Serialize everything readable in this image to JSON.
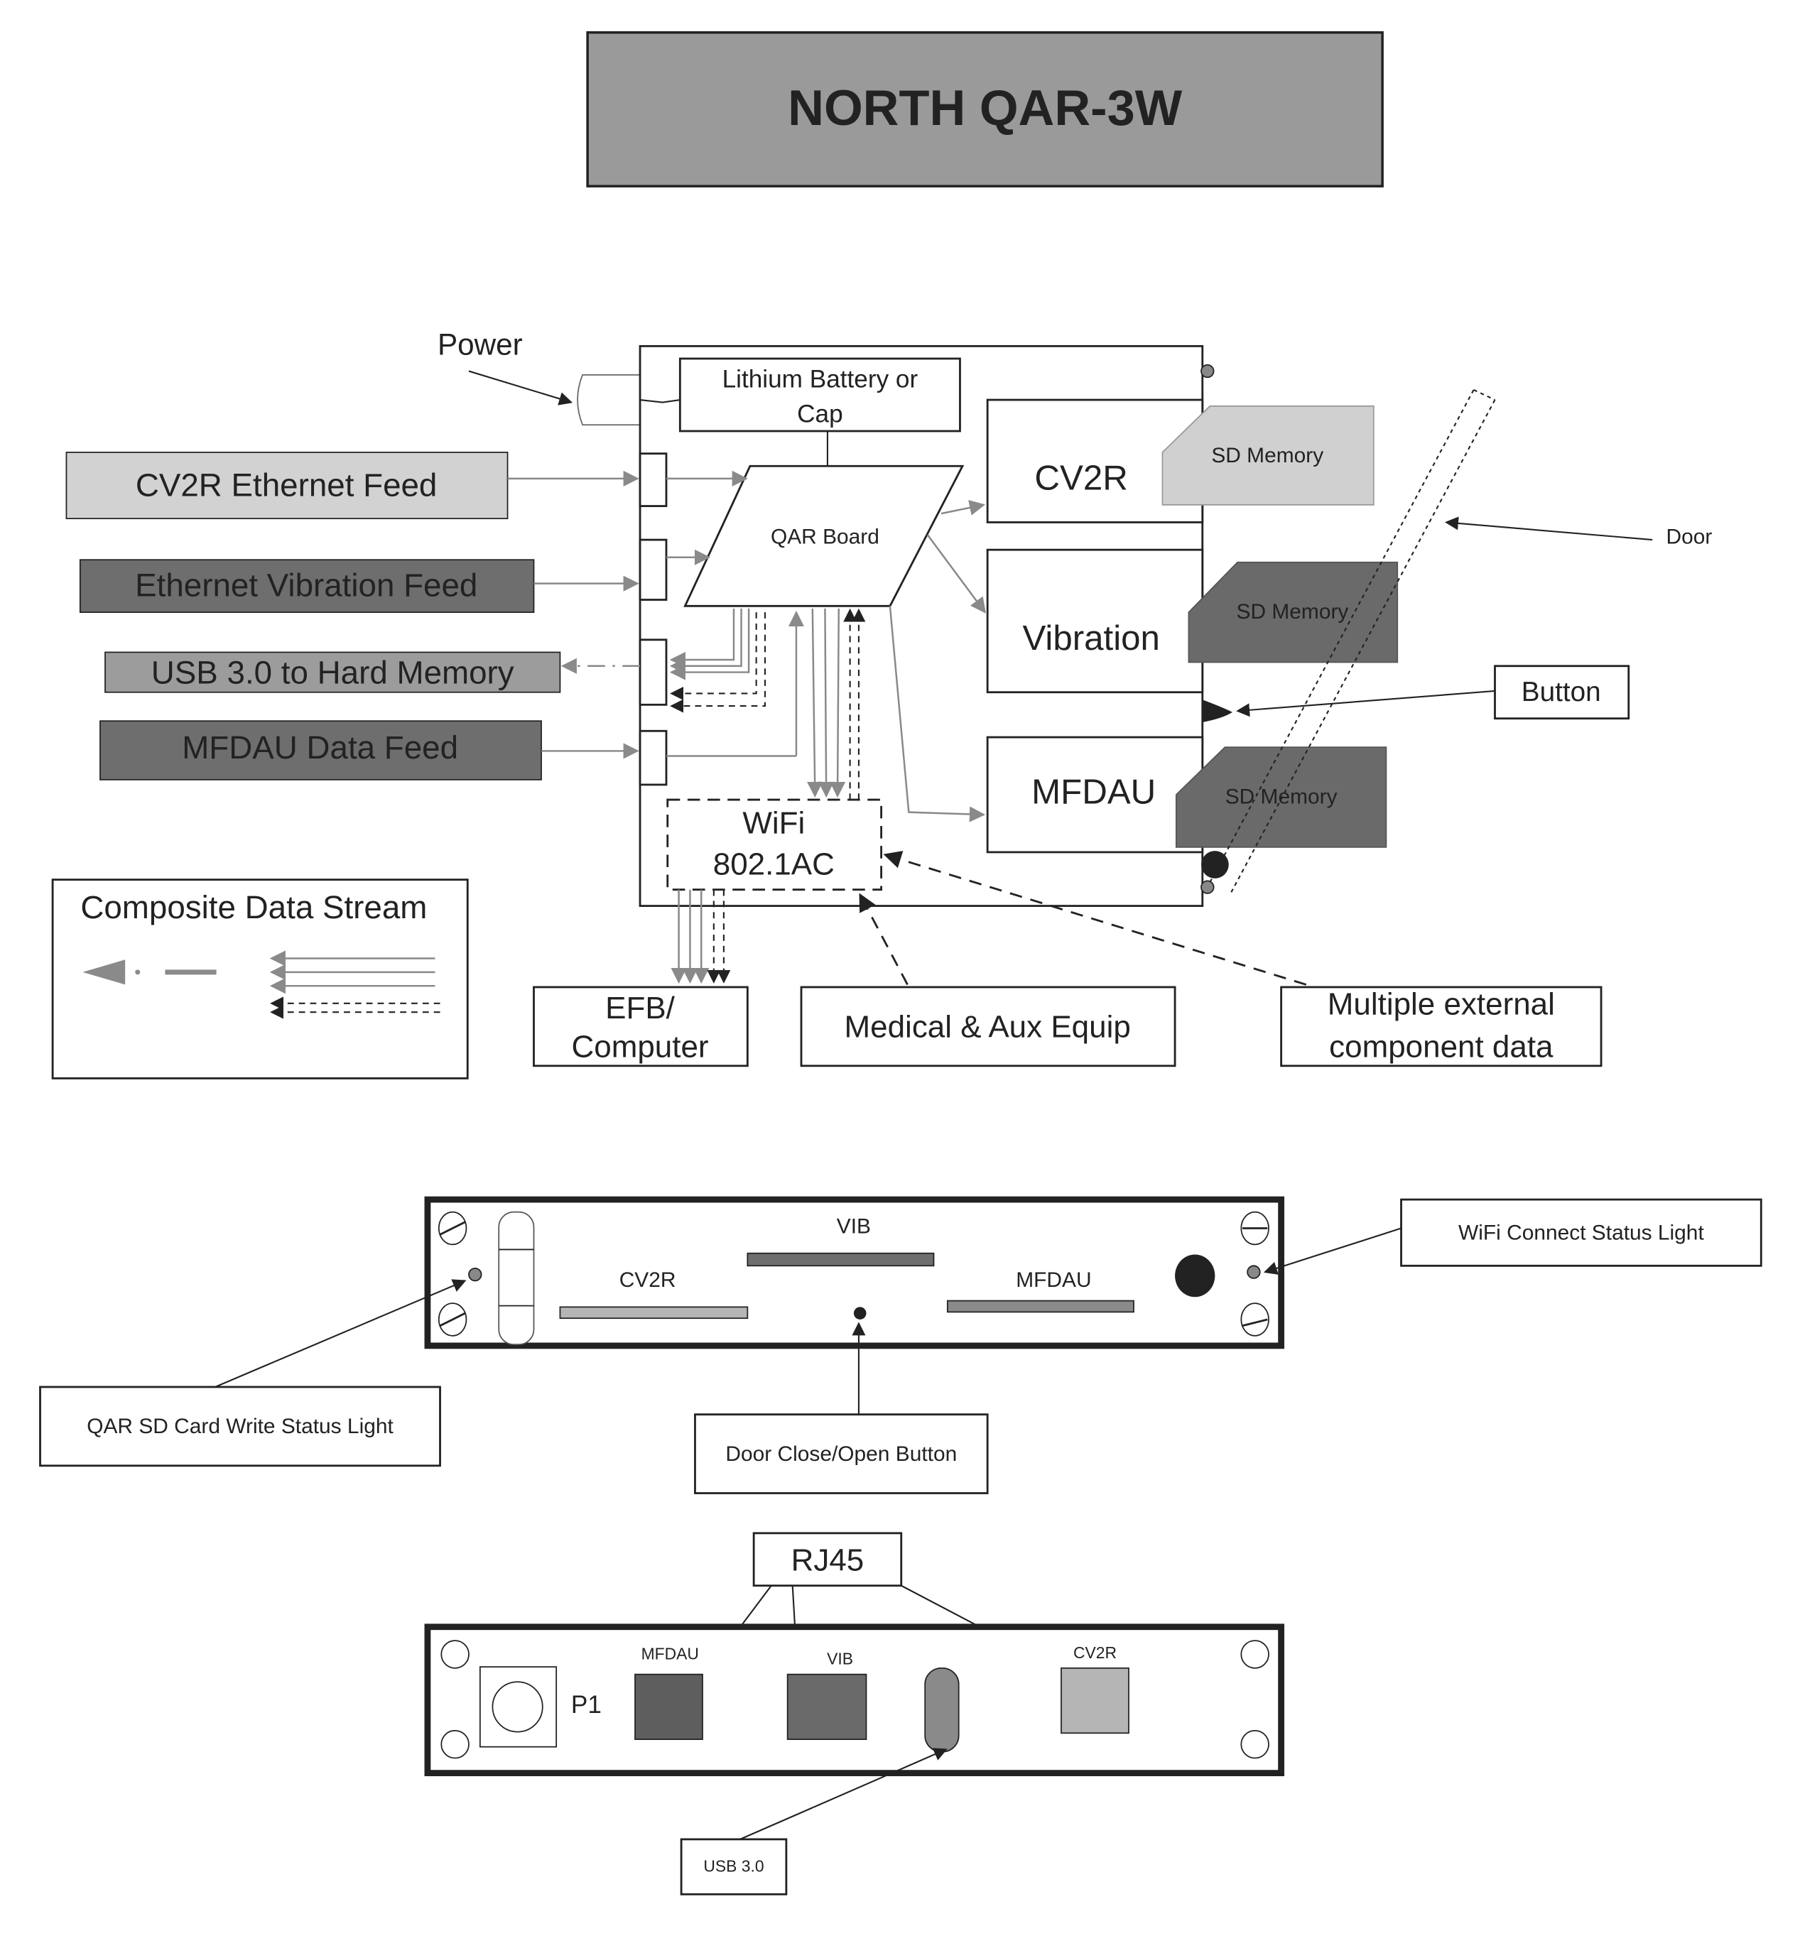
{
  "title": "NORTH QAR-3W",
  "colors": {
    "title_bg": "#9a9a9a",
    "feed_light": "#d2d2d2",
    "feed_dark": "#6e6e6e",
    "feed_mid": "#9c9c9c",
    "sd_light": "#d0d0d0",
    "sd_dark": "#6a6a6a",
    "arrow_gray": "#8a8a8a"
  },
  "block_diagram": {
    "power_label": "Power",
    "battery_label": [
      "Lithium Battery or",
      "Cap"
    ],
    "qar_board_label": "QAR Board",
    "modules": [
      {
        "label": "CV2R",
        "sd_label": "SD Memory"
      },
      {
        "label": "Vibration",
        "sd_label": "SD Memory"
      },
      {
        "label": "MFDAU",
        "sd_label": "SD Memory"
      }
    ],
    "wifi_label": [
      "WiFi",
      "802.1AC"
    ],
    "feeds": [
      {
        "label": "CV2R Ethernet Feed",
        "direction": "in"
      },
      {
        "label": "Ethernet Vibration Feed",
        "direction": "in"
      },
      {
        "label": "USB 3.0 to Hard Memory",
        "direction": "out"
      },
      {
        "label": "MFDAU Data Feed",
        "direction": "in"
      }
    ],
    "door_label": "Door",
    "button_label": "Button",
    "legend_title": "Composite Data Stream",
    "external": [
      {
        "label": [
          "EFB/",
          "Computer"
        ]
      },
      {
        "label": [
          "Medical & Aux Equip"
        ]
      },
      {
        "label": [
          "Multiple external",
          "component data"
        ]
      }
    ]
  },
  "front_panel": {
    "slots": [
      "VIB",
      "CV2R",
      "MFDAU"
    ],
    "callouts": {
      "wifi_light": "WiFi Connect Status Light",
      "sd_write_light": "QAR SD Card Write Status Light",
      "door_button": "Door Close/Open Button"
    }
  },
  "back_panel": {
    "rj45_label": "RJ45",
    "ports": [
      "MFDAU",
      "VIB",
      "CV2R"
    ],
    "p1_label": "P1",
    "usb_label": "USB 3.0"
  }
}
